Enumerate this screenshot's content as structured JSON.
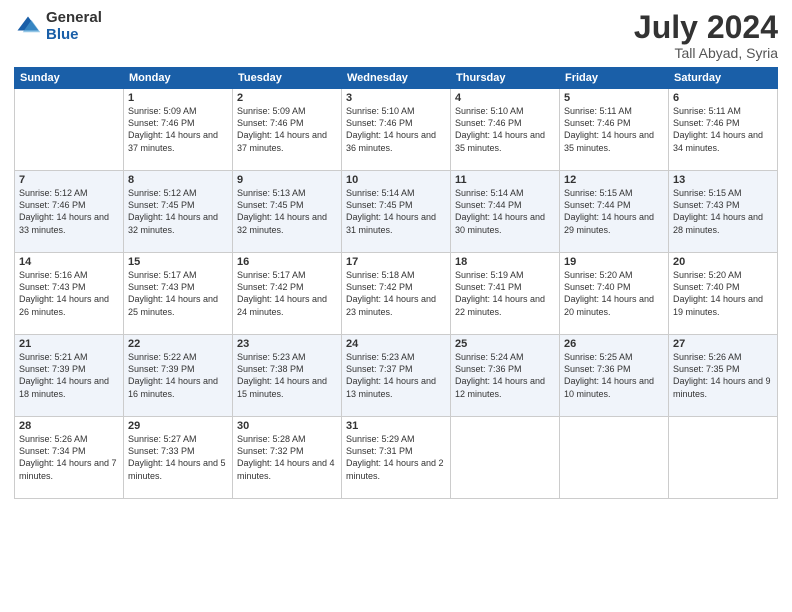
{
  "logo": {
    "general": "General",
    "blue": "Blue"
  },
  "title": {
    "month": "July 2024",
    "location": "Tall Abyad, Syria"
  },
  "days": [
    "Sunday",
    "Monday",
    "Tuesday",
    "Wednesday",
    "Thursday",
    "Friday",
    "Saturday"
  ],
  "weeks": [
    [
      {
        "date": "",
        "sunrise": "",
        "sunset": "",
        "daylight": ""
      },
      {
        "date": "1",
        "sunrise": "Sunrise: 5:09 AM",
        "sunset": "Sunset: 7:46 PM",
        "daylight": "Daylight: 14 hours and 37 minutes."
      },
      {
        "date": "2",
        "sunrise": "Sunrise: 5:09 AM",
        "sunset": "Sunset: 7:46 PM",
        "daylight": "Daylight: 14 hours and 37 minutes."
      },
      {
        "date": "3",
        "sunrise": "Sunrise: 5:10 AM",
        "sunset": "Sunset: 7:46 PM",
        "daylight": "Daylight: 14 hours and 36 minutes."
      },
      {
        "date": "4",
        "sunrise": "Sunrise: 5:10 AM",
        "sunset": "Sunset: 7:46 PM",
        "daylight": "Daylight: 14 hours and 35 minutes."
      },
      {
        "date": "5",
        "sunrise": "Sunrise: 5:11 AM",
        "sunset": "Sunset: 7:46 PM",
        "daylight": "Daylight: 14 hours and 35 minutes."
      },
      {
        "date": "6",
        "sunrise": "Sunrise: 5:11 AM",
        "sunset": "Sunset: 7:46 PM",
        "daylight": "Daylight: 14 hours and 34 minutes."
      }
    ],
    [
      {
        "date": "7",
        "sunrise": "Sunrise: 5:12 AM",
        "sunset": "Sunset: 7:46 PM",
        "daylight": "Daylight: 14 hours and 33 minutes."
      },
      {
        "date": "8",
        "sunrise": "Sunrise: 5:12 AM",
        "sunset": "Sunset: 7:45 PM",
        "daylight": "Daylight: 14 hours and 32 minutes."
      },
      {
        "date": "9",
        "sunrise": "Sunrise: 5:13 AM",
        "sunset": "Sunset: 7:45 PM",
        "daylight": "Daylight: 14 hours and 32 minutes."
      },
      {
        "date": "10",
        "sunrise": "Sunrise: 5:14 AM",
        "sunset": "Sunset: 7:45 PM",
        "daylight": "Daylight: 14 hours and 31 minutes."
      },
      {
        "date": "11",
        "sunrise": "Sunrise: 5:14 AM",
        "sunset": "Sunset: 7:44 PM",
        "daylight": "Daylight: 14 hours and 30 minutes."
      },
      {
        "date": "12",
        "sunrise": "Sunrise: 5:15 AM",
        "sunset": "Sunset: 7:44 PM",
        "daylight": "Daylight: 14 hours and 29 minutes."
      },
      {
        "date": "13",
        "sunrise": "Sunrise: 5:15 AM",
        "sunset": "Sunset: 7:43 PM",
        "daylight": "Daylight: 14 hours and 28 minutes."
      }
    ],
    [
      {
        "date": "14",
        "sunrise": "Sunrise: 5:16 AM",
        "sunset": "Sunset: 7:43 PM",
        "daylight": "Daylight: 14 hours and 26 minutes."
      },
      {
        "date": "15",
        "sunrise": "Sunrise: 5:17 AM",
        "sunset": "Sunset: 7:43 PM",
        "daylight": "Daylight: 14 hours and 25 minutes."
      },
      {
        "date": "16",
        "sunrise": "Sunrise: 5:17 AM",
        "sunset": "Sunset: 7:42 PM",
        "daylight": "Daylight: 14 hours and 24 minutes."
      },
      {
        "date": "17",
        "sunrise": "Sunrise: 5:18 AM",
        "sunset": "Sunset: 7:42 PM",
        "daylight": "Daylight: 14 hours and 23 minutes."
      },
      {
        "date": "18",
        "sunrise": "Sunrise: 5:19 AM",
        "sunset": "Sunset: 7:41 PM",
        "daylight": "Daylight: 14 hours and 22 minutes."
      },
      {
        "date": "19",
        "sunrise": "Sunrise: 5:20 AM",
        "sunset": "Sunset: 7:40 PM",
        "daylight": "Daylight: 14 hours and 20 minutes."
      },
      {
        "date": "20",
        "sunrise": "Sunrise: 5:20 AM",
        "sunset": "Sunset: 7:40 PM",
        "daylight": "Daylight: 14 hours and 19 minutes."
      }
    ],
    [
      {
        "date": "21",
        "sunrise": "Sunrise: 5:21 AM",
        "sunset": "Sunset: 7:39 PM",
        "daylight": "Daylight: 14 hours and 18 minutes."
      },
      {
        "date": "22",
        "sunrise": "Sunrise: 5:22 AM",
        "sunset": "Sunset: 7:39 PM",
        "daylight": "Daylight: 14 hours and 16 minutes."
      },
      {
        "date": "23",
        "sunrise": "Sunrise: 5:23 AM",
        "sunset": "Sunset: 7:38 PM",
        "daylight": "Daylight: 14 hours and 15 minutes."
      },
      {
        "date": "24",
        "sunrise": "Sunrise: 5:23 AM",
        "sunset": "Sunset: 7:37 PM",
        "daylight": "Daylight: 14 hours and 13 minutes."
      },
      {
        "date": "25",
        "sunrise": "Sunrise: 5:24 AM",
        "sunset": "Sunset: 7:36 PM",
        "daylight": "Daylight: 14 hours and 12 minutes."
      },
      {
        "date": "26",
        "sunrise": "Sunrise: 5:25 AM",
        "sunset": "Sunset: 7:36 PM",
        "daylight": "Daylight: 14 hours and 10 minutes."
      },
      {
        "date": "27",
        "sunrise": "Sunrise: 5:26 AM",
        "sunset": "Sunset: 7:35 PM",
        "daylight": "Daylight: 14 hours and 9 minutes."
      }
    ],
    [
      {
        "date": "28",
        "sunrise": "Sunrise: 5:26 AM",
        "sunset": "Sunset: 7:34 PM",
        "daylight": "Daylight: 14 hours and 7 minutes."
      },
      {
        "date": "29",
        "sunrise": "Sunrise: 5:27 AM",
        "sunset": "Sunset: 7:33 PM",
        "daylight": "Daylight: 14 hours and 5 minutes."
      },
      {
        "date": "30",
        "sunrise": "Sunrise: 5:28 AM",
        "sunset": "Sunset: 7:32 PM",
        "daylight": "Daylight: 14 hours and 4 minutes."
      },
      {
        "date": "31",
        "sunrise": "Sunrise: 5:29 AM",
        "sunset": "Sunset: 7:31 PM",
        "daylight": "Daylight: 14 hours and 2 minutes."
      },
      {
        "date": "",
        "sunrise": "",
        "sunset": "",
        "daylight": ""
      },
      {
        "date": "",
        "sunrise": "",
        "sunset": "",
        "daylight": ""
      },
      {
        "date": "",
        "sunrise": "",
        "sunset": "",
        "daylight": ""
      }
    ]
  ]
}
